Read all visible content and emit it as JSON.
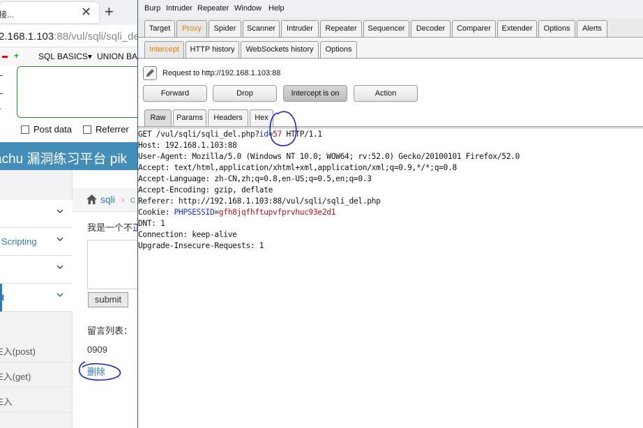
{
  "browser": {
    "tab_title": "接...",
    "url_host": "2.168.1.103",
    "url_path": ":88/vul/sqli/sqli_de",
    "hackbar": {
      "sql_basics": "SQL BASICS▾",
      "union": "UNION BA",
      "side_labels": [
        "L",
        "L",
        "-"
      ],
      "post_data": "Post data",
      "referrer": "Referrer"
    },
    "header_title": "achu 漏洞练习平台 pik",
    "nav": [
      {
        "label": "",
        "chevron": "⌄"
      },
      {
        "label": "Scripting",
        "chevron": "⌄"
      },
      {
        "label": "",
        "chevron": "⌄"
      },
      {
        "label": "t",
        "chevron": "⌄"
      }
    ],
    "subnav": [
      "E入(post)",
      "E入(get)",
      "E入"
    ],
    "breadcrumb": {
      "link": "sqli",
      "sep": "›",
      "rest": "c"
    },
    "message_label": "我是一个不正",
    "submit_label": "submit",
    "list_label": "留言列表：",
    "entry_text": "0909",
    "delete_link": "删除"
  },
  "burp": {
    "menus": [
      "Burp",
      "Intruder",
      "Repeater",
      "Window",
      "Help"
    ],
    "top_tabs": [
      "Target",
      "Proxy",
      "Spider",
      "Scanner",
      "Intruder",
      "Repeater",
      "Sequencer",
      "Decoder",
      "Comparer",
      "Extender",
      "Options",
      "Alerts"
    ],
    "selected_top_tab": "Proxy",
    "proxy_tabs": [
      "Intercept",
      "HTTP history",
      "WebSockets history",
      "Options"
    ],
    "selected_proxy_tab": "Intercept",
    "request_label": "Request to http://192.168.1.103:88",
    "buttons": {
      "forward": "Forward",
      "drop": "Drop",
      "intercept": "Intercept is on",
      "action": "Action"
    },
    "editor_tabs": [
      "Raw",
      "Params",
      "Headers",
      "Hex"
    ],
    "selected_editor_tab": "Raw",
    "request": {
      "line1_pre": "GET /vul/sqli/sqli_del.php?",
      "line1_param": "id",
      "line1_eq": "=",
      "line1_val": "57",
      "line1_post": " HTTP/1.1",
      "host": "Host: 192.168.1.103:88",
      "ua": "User-Agent: Mozilla/5.0 (Windows NT 10.0; WOW64; rv:52.0) Gecko/20100101 Firefox/52.0",
      "accept": "Accept: text/html,application/xhtml+xml,application/xml;q=0.9,*/*;q=0.8",
      "lang": "Accept-Language: zh-CN,zh;q=0.8,en-US;q=0.5,en;q=0.3",
      "enc": "Accept-Encoding: gzip, deflate",
      "referer": "Referer: http://192.168.1.103:88/vul/sqli/sqli_del.php",
      "cookie_key": "Cookie: ",
      "cookie_name": "PHPSESSID",
      "cookie_eq": "=",
      "cookie_val": "gfh8jqfhftupvfprvhuc93e2d1",
      "dnt": "DNT: 1",
      "conn": "Connection: keep-alive",
      "upgrade": "Upgrade-Insecure-Requests: 1"
    }
  },
  "colors": {
    "accent_orange": "#e67a0a",
    "pikachu_blue": "#438eb9",
    "annotation_blue": "#1a22d8"
  }
}
